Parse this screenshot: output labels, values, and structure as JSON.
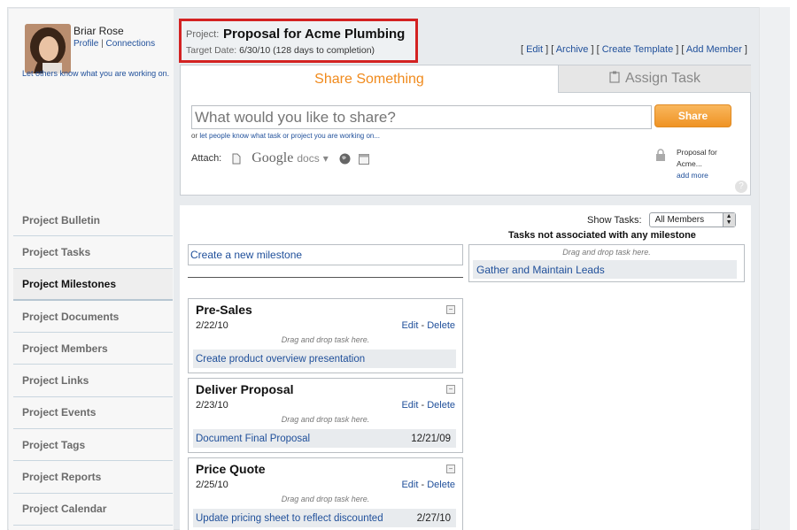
{
  "user": {
    "name": "Briar Rose",
    "profile_link": "Profile",
    "connections_link": "Connections",
    "link_separator": "|",
    "status_hint": "Let others know what you are working on."
  },
  "project": {
    "label": "Project:",
    "title": "Proposal for Acme Plumbing",
    "target_label": "Target Date:",
    "target_value": "6/30/10  (128 days to completion)",
    "actions": [
      "Edit",
      "Archive",
      "Create Template",
      "Add Member"
    ]
  },
  "share": {
    "tab_share": "Share Something",
    "tab_assign": "Assign Task",
    "input_placeholder": "What would you like to share?",
    "share_button": "Share",
    "hint_prefix": "or",
    "hint_link": "let people know what task or project you are working on...",
    "attach_label": "Attach:",
    "google": "Google",
    "docs": "docs",
    "privacy_line1": "Proposal for",
    "privacy_line2": "Acme...",
    "add_more": "add more"
  },
  "nav": {
    "items": [
      {
        "label": "Project Bulletin",
        "active": false
      },
      {
        "label": "Project Tasks",
        "active": false
      },
      {
        "label": "Project Milestones",
        "active": true
      },
      {
        "label": "Project Documents",
        "active": false
      },
      {
        "label": "Project Members",
        "active": false
      },
      {
        "label": "Project Links",
        "active": false
      },
      {
        "label": "Project Events",
        "active": false
      },
      {
        "label": "Project Tags",
        "active": false
      },
      {
        "label": "Project Reports",
        "active": false
      },
      {
        "label": "Project Calendar",
        "active": false
      }
    ]
  },
  "board": {
    "show_tasks_label": "Show Tasks:",
    "show_tasks_value": "All Members",
    "unassociated_title": "Tasks not associated with any milestone",
    "drop_hint": "Drag and drop task here.",
    "unassociated_task": "Gather and Maintain Leads",
    "create_milestone": "Create a new milestone",
    "edit_label": "Edit",
    "delete_label": "Delete",
    "milestones": [
      {
        "title": "Pre-Sales",
        "date": "2/22/10",
        "task": "Create product overview presentation",
        "task_due": ""
      },
      {
        "title": "Deliver Proposal",
        "date": "2/23/10",
        "task": "Document Final Proposal",
        "task_due": "12/21/09"
      },
      {
        "title": "Price Quote",
        "date": "2/25/10",
        "task": "Update pricing sheet to reflect discounted",
        "task_due": "2/27/10"
      }
    ]
  },
  "colors": {
    "accent_orange": "#f08a1c",
    "link_blue": "#1f4f9a",
    "highlight_red": "#d32222"
  }
}
